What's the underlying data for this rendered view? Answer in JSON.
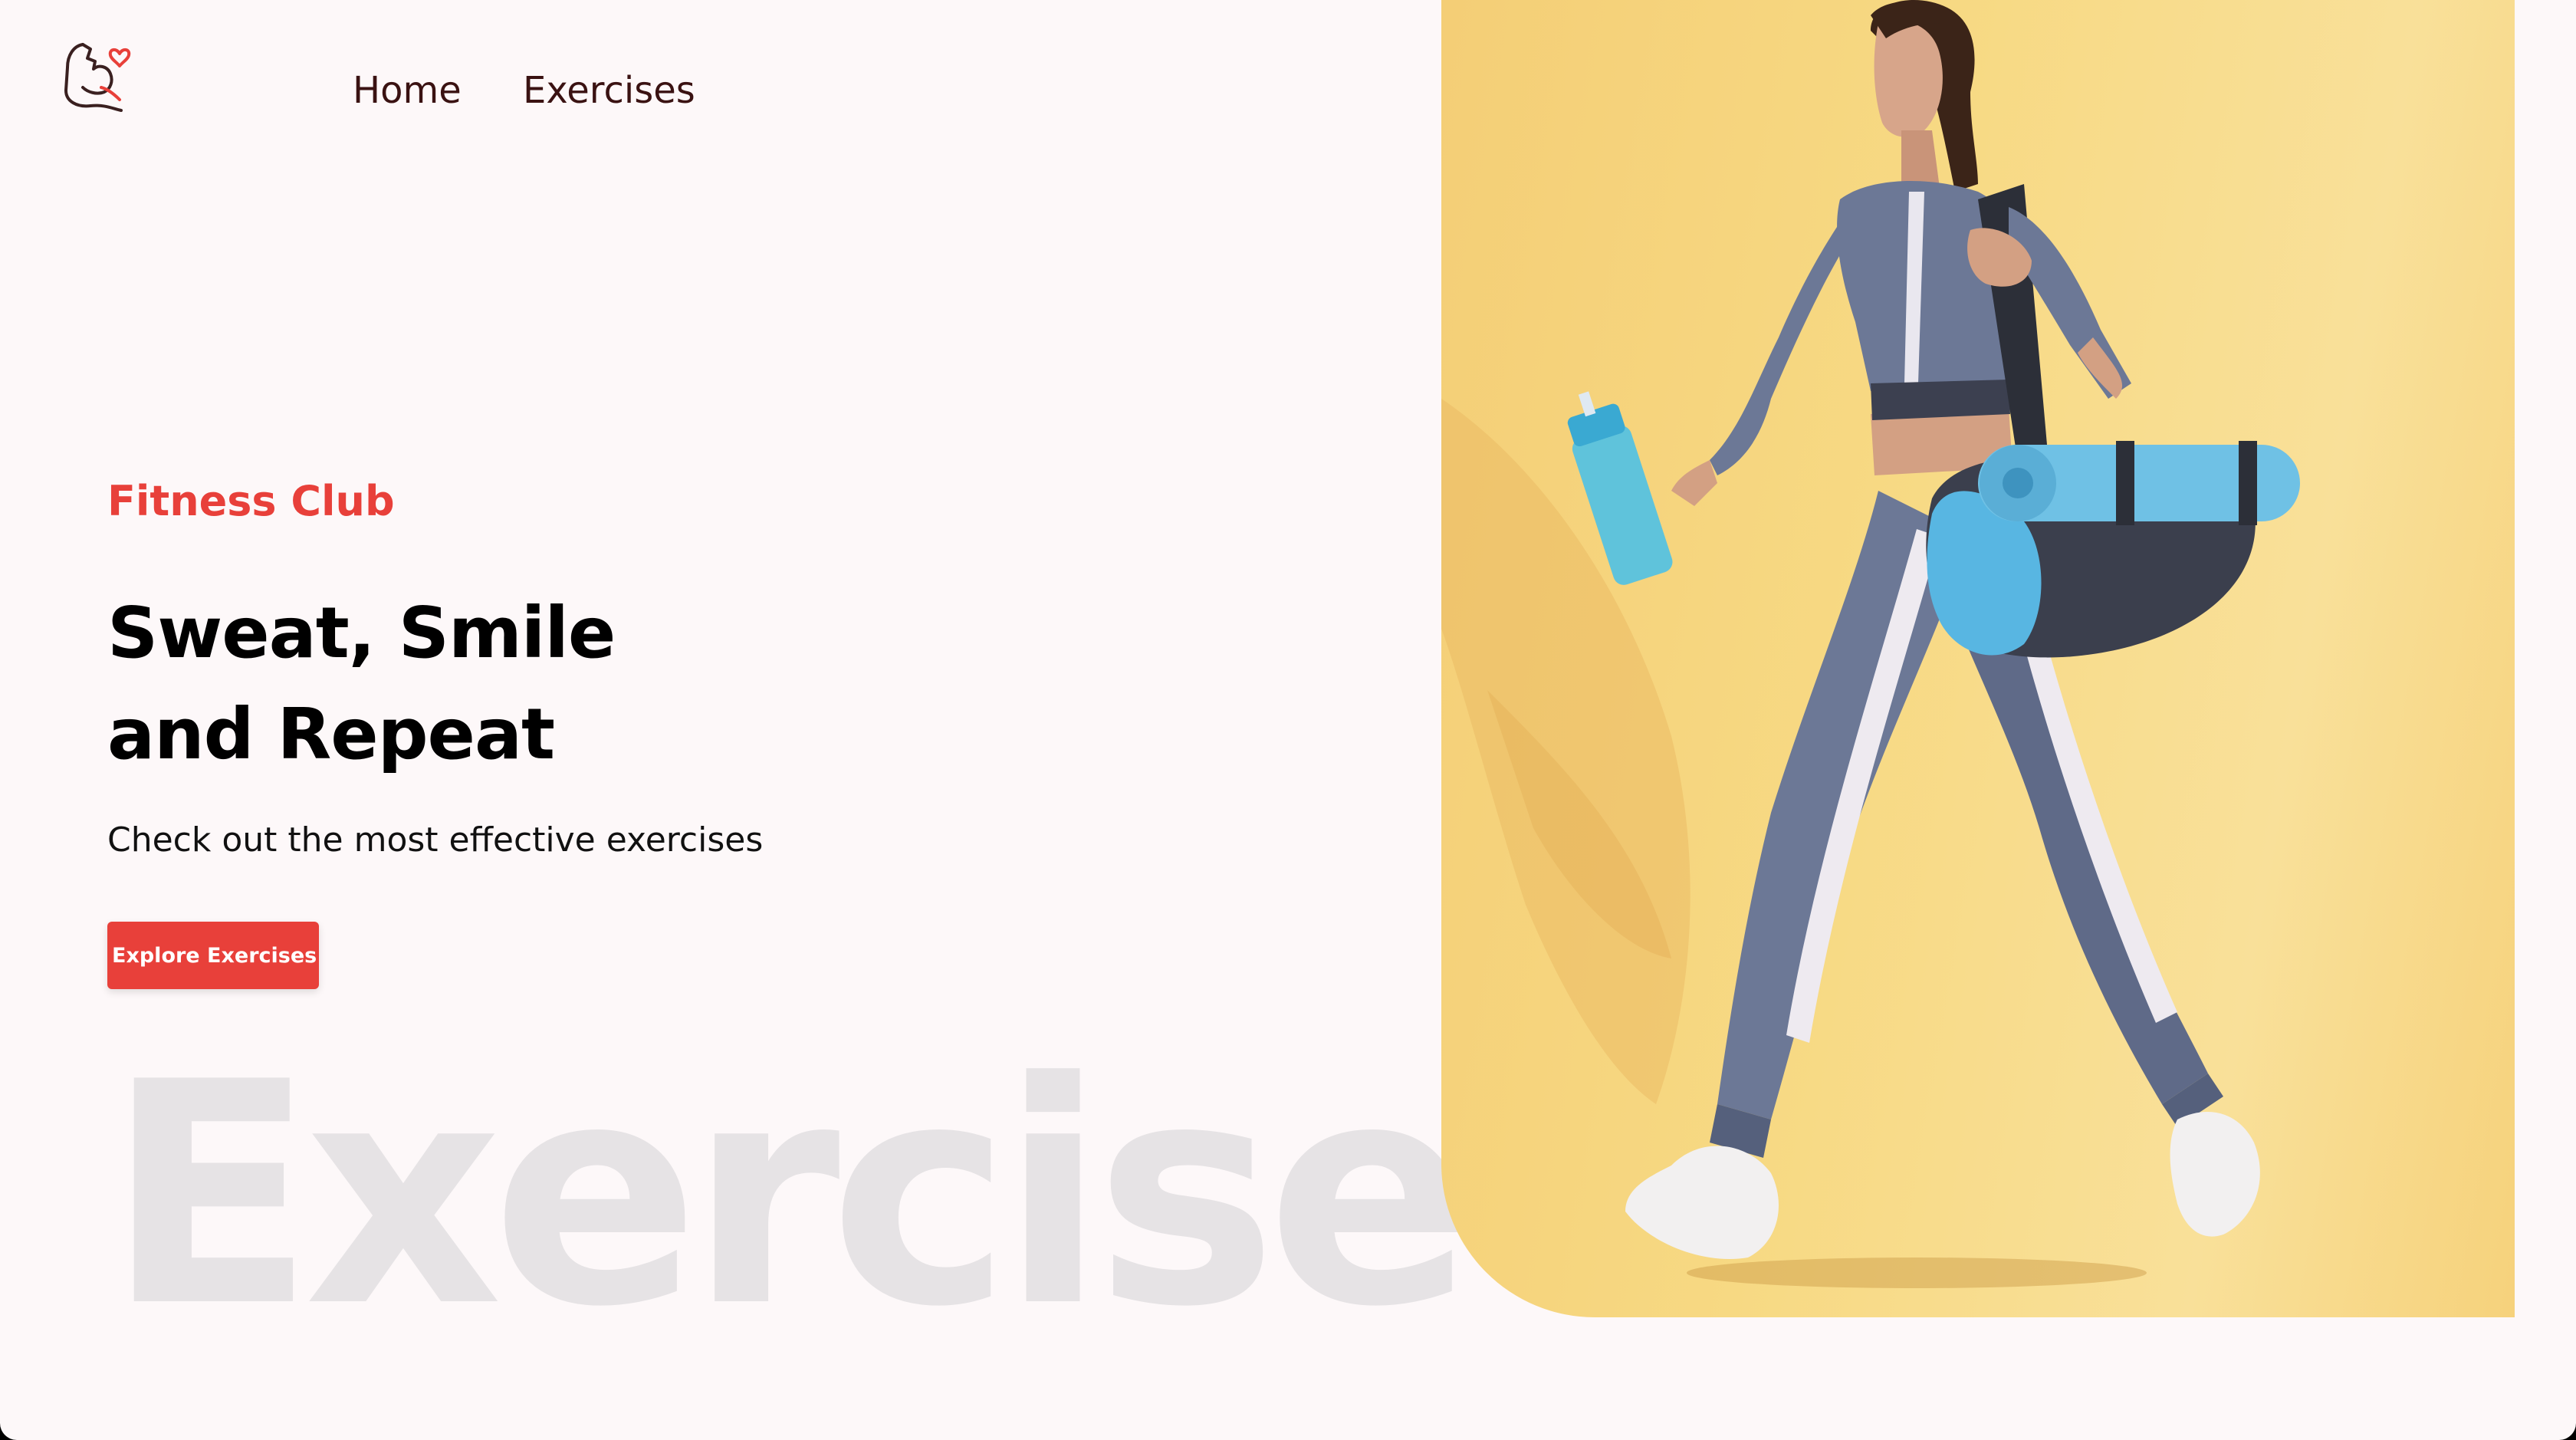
{
  "navbar": {
    "logo_icon": "flexed-arm-heart-icon",
    "links": [
      {
        "label": "Home"
      },
      {
        "label": "Exercises"
      }
    ]
  },
  "hero": {
    "eyebrow": "Fitness Club",
    "headline_line1": "Sweat, Smile",
    "headline_line2": "and Repeat",
    "subtext": "Check out the most effective exercises",
    "cta_label": "Explore Exercises",
    "watermark": "Exercise"
  },
  "banner": {
    "image_alt": "banner",
    "background_color": "#f7d983"
  },
  "colors": {
    "accent": "#e8403a",
    "page_background": "#fdf8f9",
    "watermark": "#e6e3e5"
  }
}
